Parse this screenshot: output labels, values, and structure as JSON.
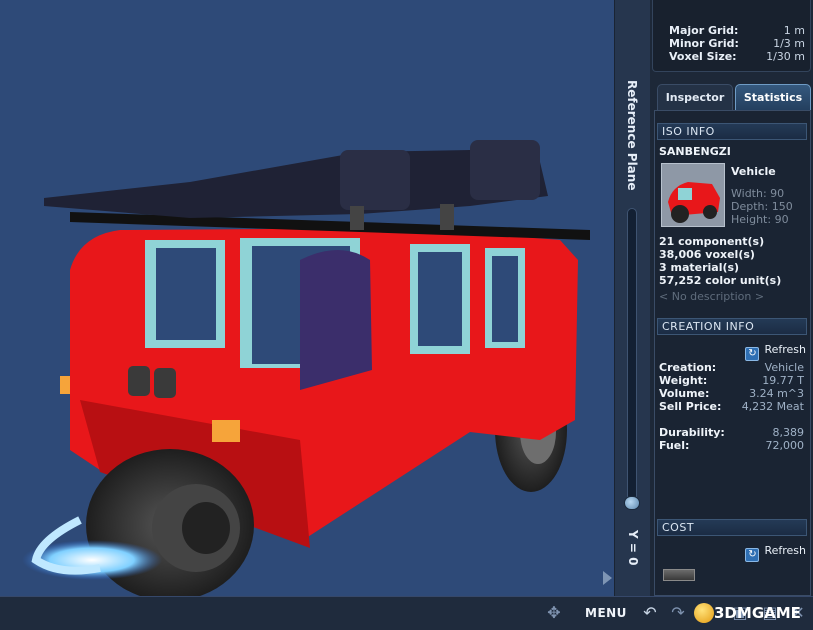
{
  "grid": {
    "major_label": "Major Grid:",
    "major_value": "1 m",
    "minor_label": "Minor Grid:",
    "minor_value": "1/3 m",
    "voxel_label": "Voxel Size:",
    "voxel_value": "1/30 m"
  },
  "reference_plane": {
    "title": "Reference Plane",
    "y_label": "Y = 0"
  },
  "tabs": {
    "inspector": "Inspector",
    "statistics": "Statistics",
    "active": "statistics"
  },
  "iso_info": {
    "header": "ISO INFO",
    "name": "SANBENGZI",
    "type": "Vehicle",
    "width": "Width: 90",
    "depth": "Depth: 150",
    "height": "Height: 90",
    "components": "21 component(s)",
    "voxels": "38,006 voxel(s)",
    "materials": "3 material(s)",
    "color_units": "57,252 color unit(s)",
    "description": "< No description >"
  },
  "creation_info": {
    "header": "CREATION INFO",
    "refresh": "Refresh",
    "rows": [
      {
        "label": "Creation:",
        "value": "Vehicle"
      },
      {
        "label": "Weight:",
        "value": "19.77 T"
      },
      {
        "label": "Volume:",
        "value": "3.24 m^3"
      },
      {
        "label": "Sell Price:",
        "value": "4,232 Meat"
      }
    ],
    "rows2": [
      {
        "label": "Durability:",
        "value": "8,389"
      },
      {
        "label": "Fuel:",
        "value": "72,000"
      }
    ]
  },
  "cost": {
    "header": "COST",
    "refresh": "Refresh"
  },
  "bottom": {
    "menu": "MENU",
    "watermark": "3DMGAME"
  },
  "colors": {
    "viewport_bg": "#2e4a78",
    "vehicle_body": "#e8171a",
    "window_frame": "#8fd3d6",
    "accent": "#6f9cc6"
  },
  "icons": [
    "refresh-icon",
    "undo-icon",
    "redo-icon",
    "save-icon",
    "export-icon",
    "close-icon"
  ]
}
